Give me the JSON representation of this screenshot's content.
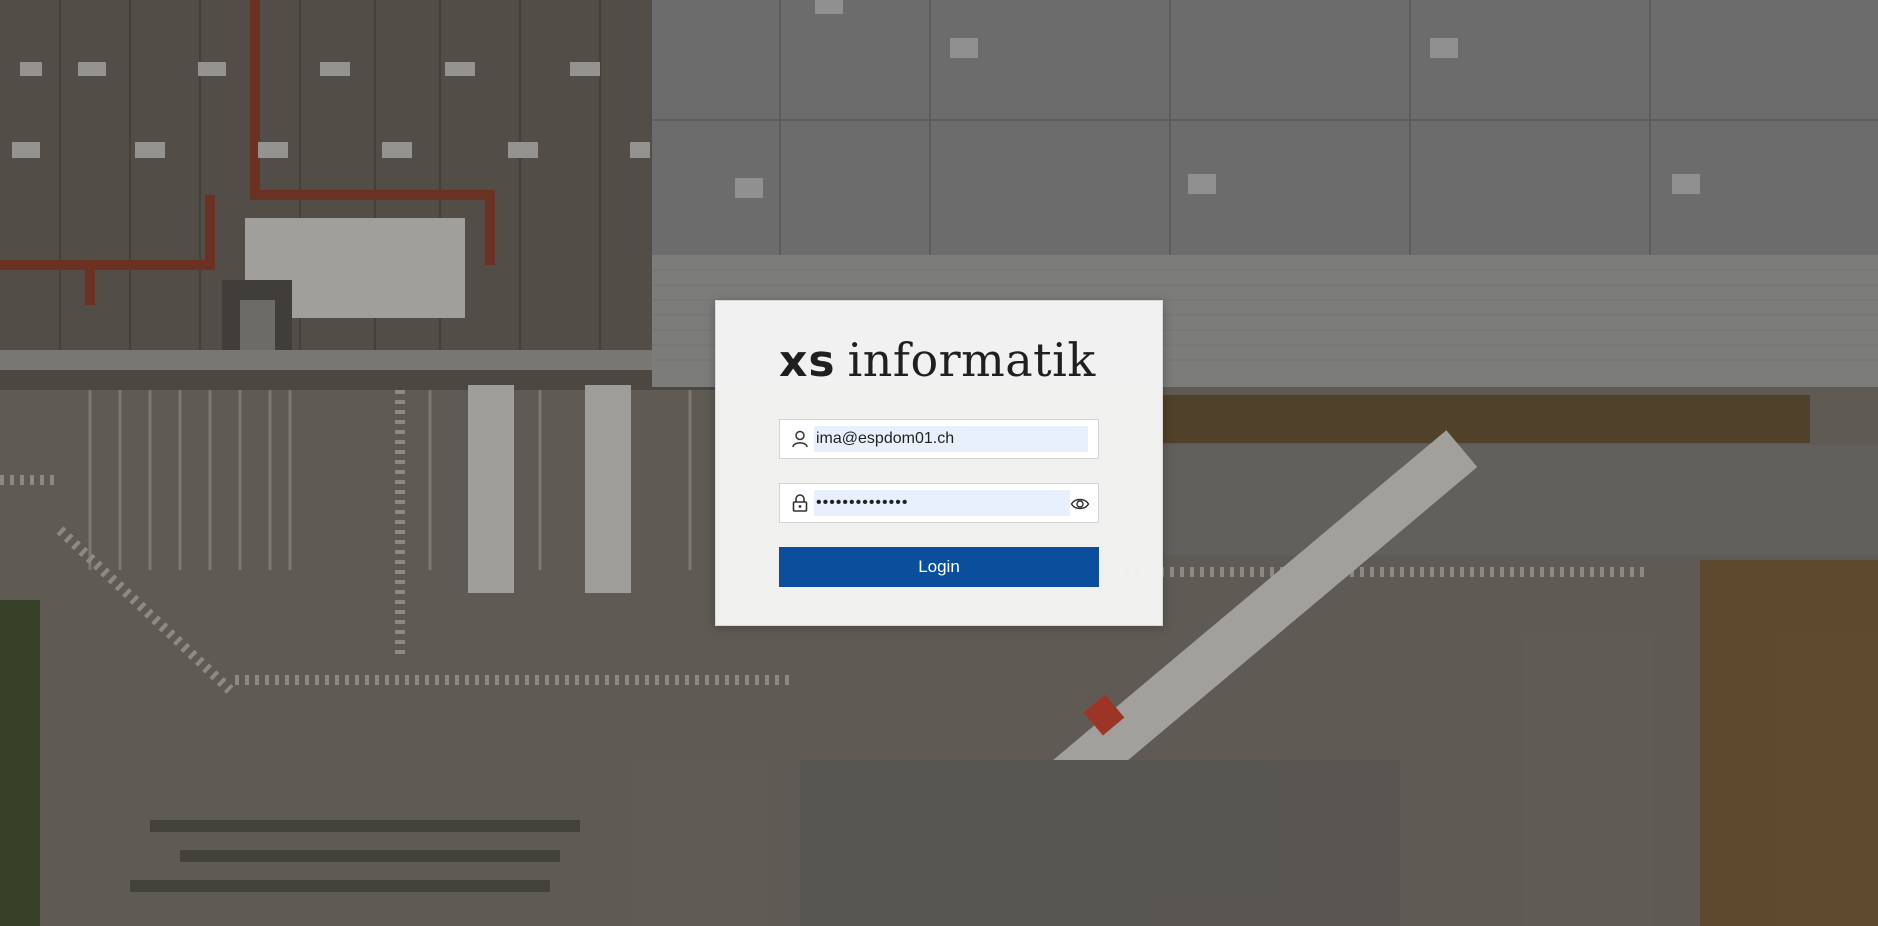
{
  "background": {
    "description_icon": "warehouse-aerial-photo"
  },
  "logo": {
    "prefix": "xs",
    "name": "informatik"
  },
  "form": {
    "username_value": "ima@espdom01.ch",
    "username_icon": "user-icon",
    "password_value": "••••••••••••••",
    "password_icon": "lock-icon",
    "toggle_icon": "eye-icon",
    "login_label": "Login"
  },
  "colors": {
    "button": "#0b4f9c",
    "autofill": "#e8f0fe",
    "card": "#f5f5f5"
  }
}
